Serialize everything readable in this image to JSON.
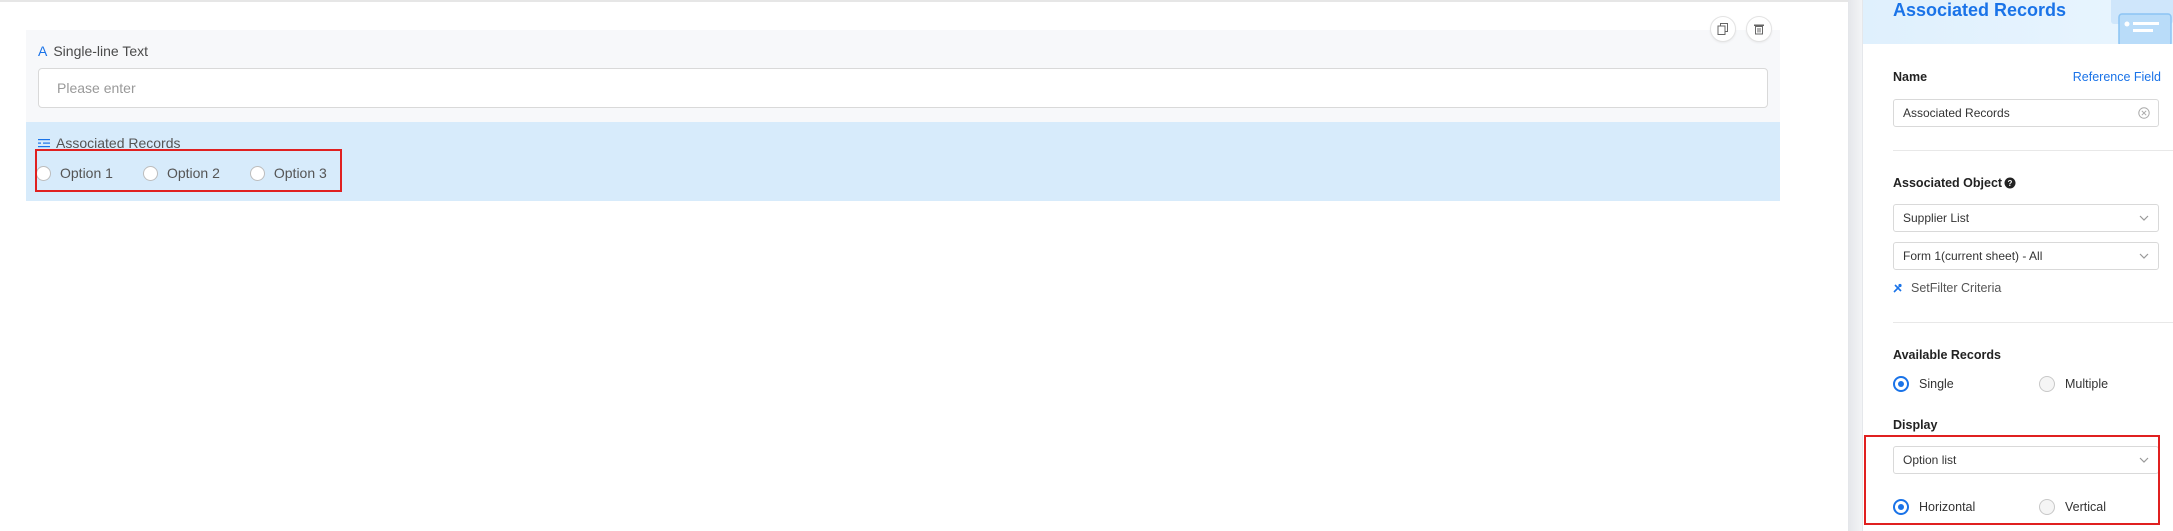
{
  "canvas": {
    "single_line": {
      "label": "Single-line Text",
      "icon": "text-a-icon",
      "placeholder": "Please enter"
    },
    "associated": {
      "label": "Associated Records",
      "icon": "link-list-icon",
      "options": [
        "Option 1",
        "Option 2",
        "Option 3"
      ]
    },
    "actions": {
      "copy_icon": "copy-icon",
      "delete_icon": "trash-icon"
    }
  },
  "panel": {
    "title": "Associated Records",
    "name_label": "Name",
    "reference_link": "Reference Field",
    "name_value": "Associated Records",
    "assoc_object_label": "Associated Object",
    "object_select": "Supplier List",
    "form_select": "Form 1(current sheet) - All",
    "filter_link": "SetFilter Criteria",
    "available_label": "Available Records",
    "available_options": {
      "single": "Single",
      "multiple": "Multiple",
      "selected": "Single"
    },
    "display_label": "Display",
    "display_select": "Option list",
    "layout_options": {
      "horizontal": "Horizontal",
      "vertical": "Vertical",
      "selected": "Horizontal"
    }
  },
  "colors": {
    "accent": "#1a73e8",
    "selected_bg": "#d7ebfb",
    "highlight": "#e02020"
  }
}
